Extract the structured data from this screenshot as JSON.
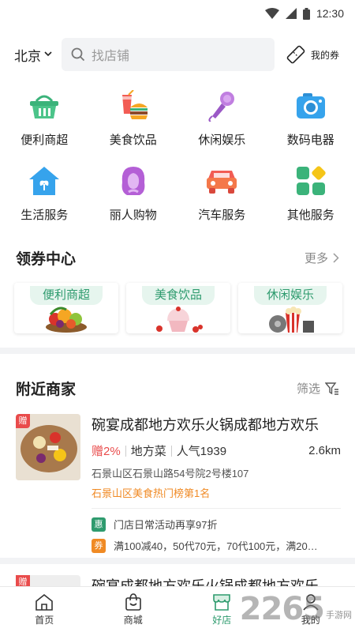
{
  "status_bar": {
    "time": "12:30"
  },
  "top_bar": {
    "city": "北京",
    "search_placeholder": "找店铺",
    "coupon_label": "我的券"
  },
  "categories": [
    {
      "label": "便利商超",
      "icon": "basket-icon"
    },
    {
      "label": "美食饮品",
      "icon": "food-drink-icon"
    },
    {
      "label": "休闲娱乐",
      "icon": "microphone-icon"
    },
    {
      "label": "数码电器",
      "icon": "camera-icon"
    },
    {
      "label": "生活服务",
      "icon": "house-icon"
    },
    {
      "label": "丽人购物",
      "icon": "woman-icon"
    },
    {
      "label": "汽车服务",
      "icon": "car-icon"
    },
    {
      "label": "其他服务",
      "icon": "grid-icon"
    }
  ],
  "coupon_center": {
    "title": "领券中心",
    "more": "更多",
    "cards": [
      {
        "tag": "便利商超",
        "image": "fruit-basket"
      },
      {
        "tag": "美食饮品",
        "image": "cupcake"
      },
      {
        "tag": "休闲娱乐",
        "image": "popcorn-film"
      }
    ]
  },
  "nearby": {
    "title": "附近商家",
    "filter": "筛选",
    "shops": [
      {
        "badge": "赠",
        "name": "碗宴成都地方欢乐火锅成都地方欢乐",
        "gift": "赠2%",
        "cuisine": "地方菜",
        "popularity": "人气1939",
        "distance": "2.6km",
        "address": "石景山区石景山路54号院2号楼107",
        "rank": "石景山区美食热门榜第1名",
        "promos": [
          {
            "icon_text": "惠",
            "color": "#2e9b6e",
            "text": "门店日常活动再享97折"
          },
          {
            "icon_text": "券",
            "color": "#f08a24",
            "text": "满100减40，50代70元，70代100元，满20…"
          }
        ]
      },
      {
        "badge": "赠",
        "name": "碗宴成都地方欢乐火锅成都地方欢乐"
      }
    ]
  },
  "bottom_nav": [
    {
      "label": "首页",
      "icon": "home-icon",
      "active": false
    },
    {
      "label": "商城",
      "icon": "shopping-bag-icon",
      "active": false
    },
    {
      "label": "好店",
      "icon": "store-icon",
      "active": true
    },
    {
      "label": "我的",
      "icon": "profile-icon",
      "active": false
    }
  ],
  "watermark": {
    "big": "2265",
    "small": "手游网"
  }
}
